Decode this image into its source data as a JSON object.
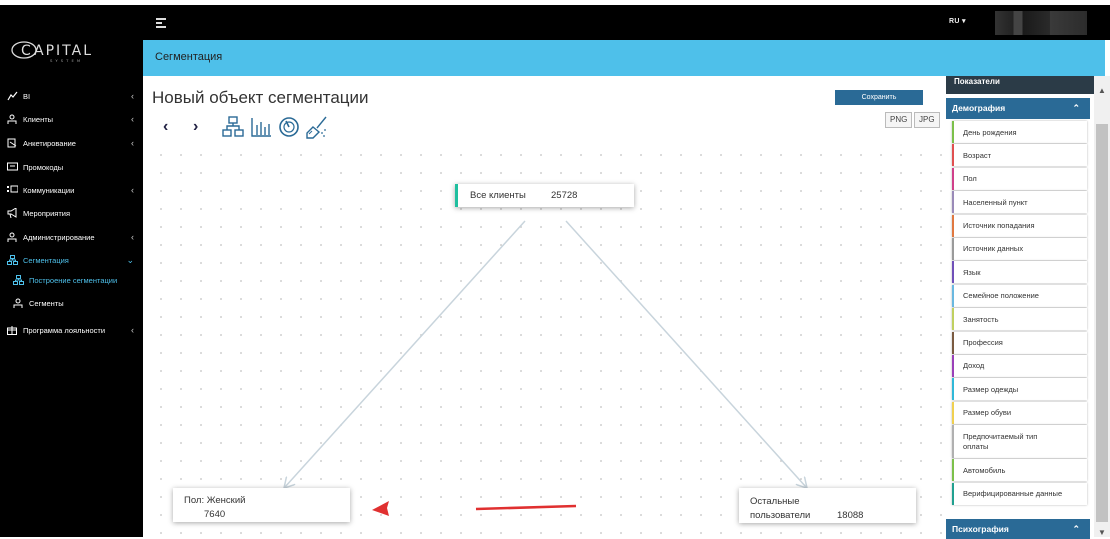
{
  "topbar": {
    "lang": "RU ▾"
  },
  "logo": {
    "text": "APITAL",
    "cap": "C",
    "sub": "SYSTEM"
  },
  "sidebar": {
    "items": [
      {
        "label": "BI",
        "icon": "chart-line-icon",
        "chevron": "‹"
      },
      {
        "label": "Клиенты",
        "icon": "user-icon",
        "chevron": "‹"
      },
      {
        "label": "Анкетирование",
        "icon": "form-icon",
        "chevron": "‹"
      },
      {
        "label": "Промокоды",
        "icon": "ticket-icon",
        "chevron": ""
      },
      {
        "label": "Коммуникации",
        "icon": "list-icon",
        "chevron": "‹"
      },
      {
        "label": "Мероприятия",
        "icon": "megaphone-icon",
        "chevron": ""
      },
      {
        "label": "Администрирование",
        "icon": "admin-icon",
        "chevron": "‹"
      },
      {
        "label": "Сегментация",
        "icon": "hierarchy-icon",
        "chevron": "⌄"
      },
      {
        "label": "Построение сегментации",
        "icon": "hierarchy-icon",
        "chevron": ""
      },
      {
        "label": "Сегменты",
        "icon": "user-icon",
        "chevron": ""
      },
      {
        "label": "Программа лояльности",
        "icon": "gift-icon",
        "chevron": "‹"
      }
    ]
  },
  "header": {
    "title": "Сегментация"
  },
  "main": {
    "title": "Новый объект сегментации",
    "save_label": "Сохранить",
    "png_label": "PNG",
    "jpg_label": "JPG"
  },
  "nodes": {
    "root": {
      "label": "Все клиенты",
      "count": "25728"
    },
    "left": {
      "label": "Пол: Женский",
      "count": "7640"
    },
    "right": {
      "label_line1": "Остальные",
      "label_line2": "пользователи",
      "count": "18088"
    }
  },
  "rpanel": {
    "top_header": "Показатели",
    "demography_header": "Демография",
    "psychography_header": "Психография",
    "items": [
      {
        "label": "День рождения",
        "color": "#7cc04a"
      },
      {
        "label": "Возраст",
        "color": "#e05050"
      },
      {
        "label": "Пол",
        "color": "#d0408a"
      },
      {
        "label": "Населенный пункт",
        "color": "#9a8ab8"
      },
      {
        "label": "Источник попадания",
        "color": "#e07840"
      },
      {
        "label": "Источник данных",
        "color": "#9a9a9a"
      },
      {
        "label": "Язык",
        "color": "#7050b8"
      },
      {
        "label": "Семейное положение",
        "color": "#6ab8e0"
      },
      {
        "label": "Занятость",
        "color": "#c0d060"
      },
      {
        "label": "Профессия",
        "color": "#7a5a40"
      },
      {
        "label": "Доход",
        "color": "#9a40b8"
      },
      {
        "label": "Размер одежды",
        "color": "#30b8d8"
      },
      {
        "label": "Размер обуви",
        "color": "#f0d050"
      },
      {
        "label": "Предпочитаемый тип оплаты",
        "color": "#b0b0b0"
      },
      {
        "label": "Автомобиль",
        "color": "#7cc04a"
      },
      {
        "label": "Верифицированные данные",
        "color": "#20a090"
      }
    ]
  }
}
